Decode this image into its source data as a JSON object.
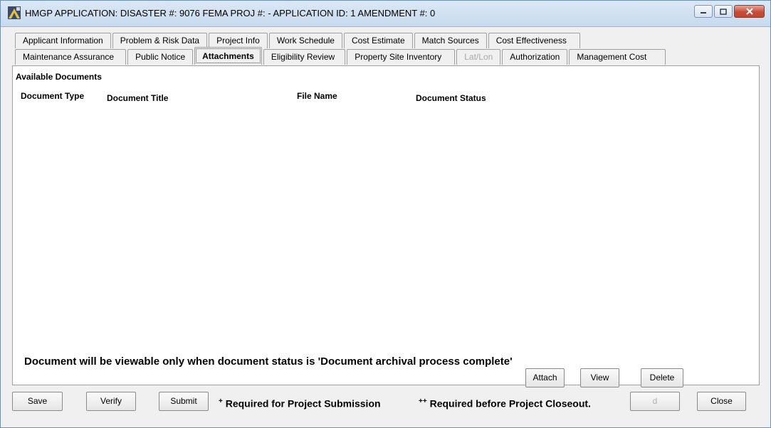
{
  "window": {
    "title": "HMGP APPLICATION:  DISASTER #: 9076   FEMA PROJ #:  -    APPLICATION ID: 1   AMENDMENT #: 0",
    "accent": "#c7daef",
    "close_color": "#c74c38"
  },
  "tabs": {
    "row1": [
      {
        "label": "Applicant Information"
      },
      {
        "label": "Problem & Risk Data"
      },
      {
        "label": "Project Info"
      },
      {
        "label": "Work Schedule"
      },
      {
        "label": "Cost Estimate"
      },
      {
        "label": "Match Sources"
      },
      {
        "label": "Cost Effectiveness"
      }
    ],
    "row2": [
      {
        "label": "Maintenance Assurance"
      },
      {
        "label": "Public Notice"
      },
      {
        "label": "Attachments"
      },
      {
        "label": "Eligibility Review"
      },
      {
        "label": "Property Site Inventory"
      },
      {
        "label": "Lat/Lon"
      },
      {
        "label": "Authorization"
      },
      {
        "label": "Management Cost"
      }
    ],
    "active": "Attachments",
    "disabled": [
      "Lat/Lon"
    ]
  },
  "attachments": {
    "section_title": "Available Documents",
    "columns": {
      "doc_type": "Document Type",
      "doc_title": "Document Title",
      "file_name": "File Name",
      "doc_status": "Document Status"
    },
    "rows": [],
    "notice": "Document will be viewable only when document status is 'Document archival process complete'",
    "attach_label": "Attach",
    "view_label": "View",
    "delete_label": "Delete"
  },
  "footer": {
    "save_label": "Save",
    "verify_label": "Verify",
    "submit_label": "Submit",
    "required_submission_mark": "+",
    "required_submission_text": "Required for Project Submission",
    "required_closeout_mark": "++",
    "required_closeout_text": "Required before Project Closeout.",
    "disabled_button_label": "d",
    "close_label": "Close"
  }
}
